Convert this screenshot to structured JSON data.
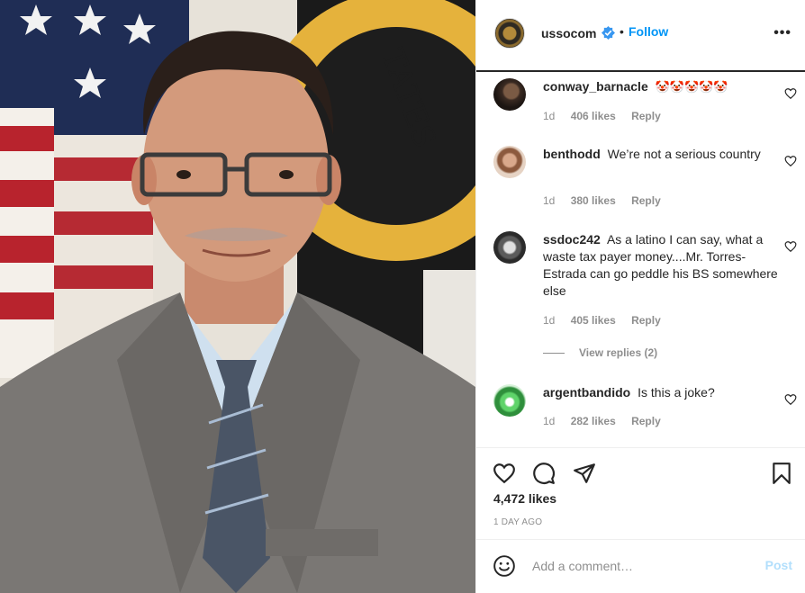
{
  "post": {
    "username": "ussocom",
    "separator": "•",
    "follow_label": "Follow",
    "more_label": "•••",
    "verified_icon": "verified-badge-icon"
  },
  "comments": [
    {
      "username": "conway_barnacle",
      "text": "🤡🤡🤡🤡🤡",
      "time": "1d",
      "likes": "406 likes",
      "reply": "Reply"
    },
    {
      "username": "benthodd",
      "text": "We’re not a serious country",
      "time": "1d",
      "likes": "380 likes",
      "reply": "Reply"
    },
    {
      "username": "ssdoc242",
      "text": "As a latino I can say, what a waste tax payer money....Mr. Torres-Estrada can go peddle his BS somewhere else",
      "time": "1d",
      "likes": "405 likes",
      "reply": "Reply"
    },
    {
      "username": "argentbandido",
      "text": "Is this a joke?",
      "time": "1d",
      "likes": "282 likes",
      "reply": "Reply"
    }
  ],
  "view_replies": "View replies (2)",
  "likes_total": "4,472 likes",
  "time_ago": "1 DAY AGO",
  "add_comment": {
    "placeholder": "Add a comment…",
    "post_label": "Post"
  },
  "colors": {
    "link_blue": "#0095f6",
    "post_disabled": "#b2dffc",
    "muted": "#8e8e8e",
    "text": "#262626"
  }
}
